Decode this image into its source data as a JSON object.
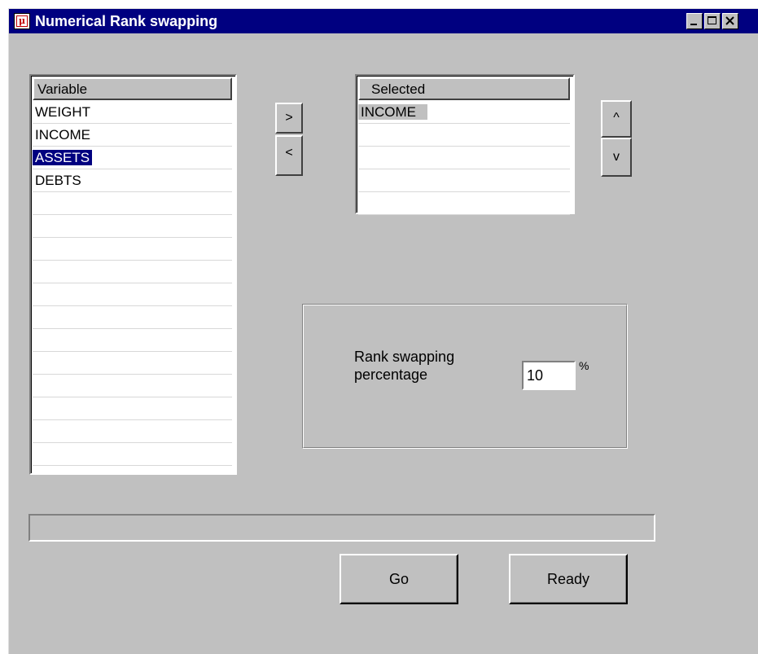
{
  "window": {
    "title": "Numerical Rank swapping",
    "icon": "app-icon",
    "controls": {
      "minimize": "minimize-icon",
      "maximize": "maximize-icon",
      "close": "close-icon"
    }
  },
  "variable_list": {
    "header": "Variable",
    "items": [
      "WEIGHT",
      "INCOME",
      "ASSETS",
      "DEBTS"
    ],
    "selected": "ASSETS"
  },
  "transfer_buttons": {
    "add": ">",
    "remove": "<"
  },
  "selected_list": {
    "header": "Selected",
    "items": [
      "INCOME"
    ]
  },
  "order_buttons": {
    "up": "^",
    "down": "v"
  },
  "percentage": {
    "label": "Rank swapping percentage",
    "value": "10",
    "unit": "%"
  },
  "progress": {
    "value": 0
  },
  "actions": {
    "go": "Go",
    "ready": "Ready"
  },
  "colors": {
    "titlebar": "#000080",
    "face": "#c0c0c0",
    "selection": "#000080"
  }
}
